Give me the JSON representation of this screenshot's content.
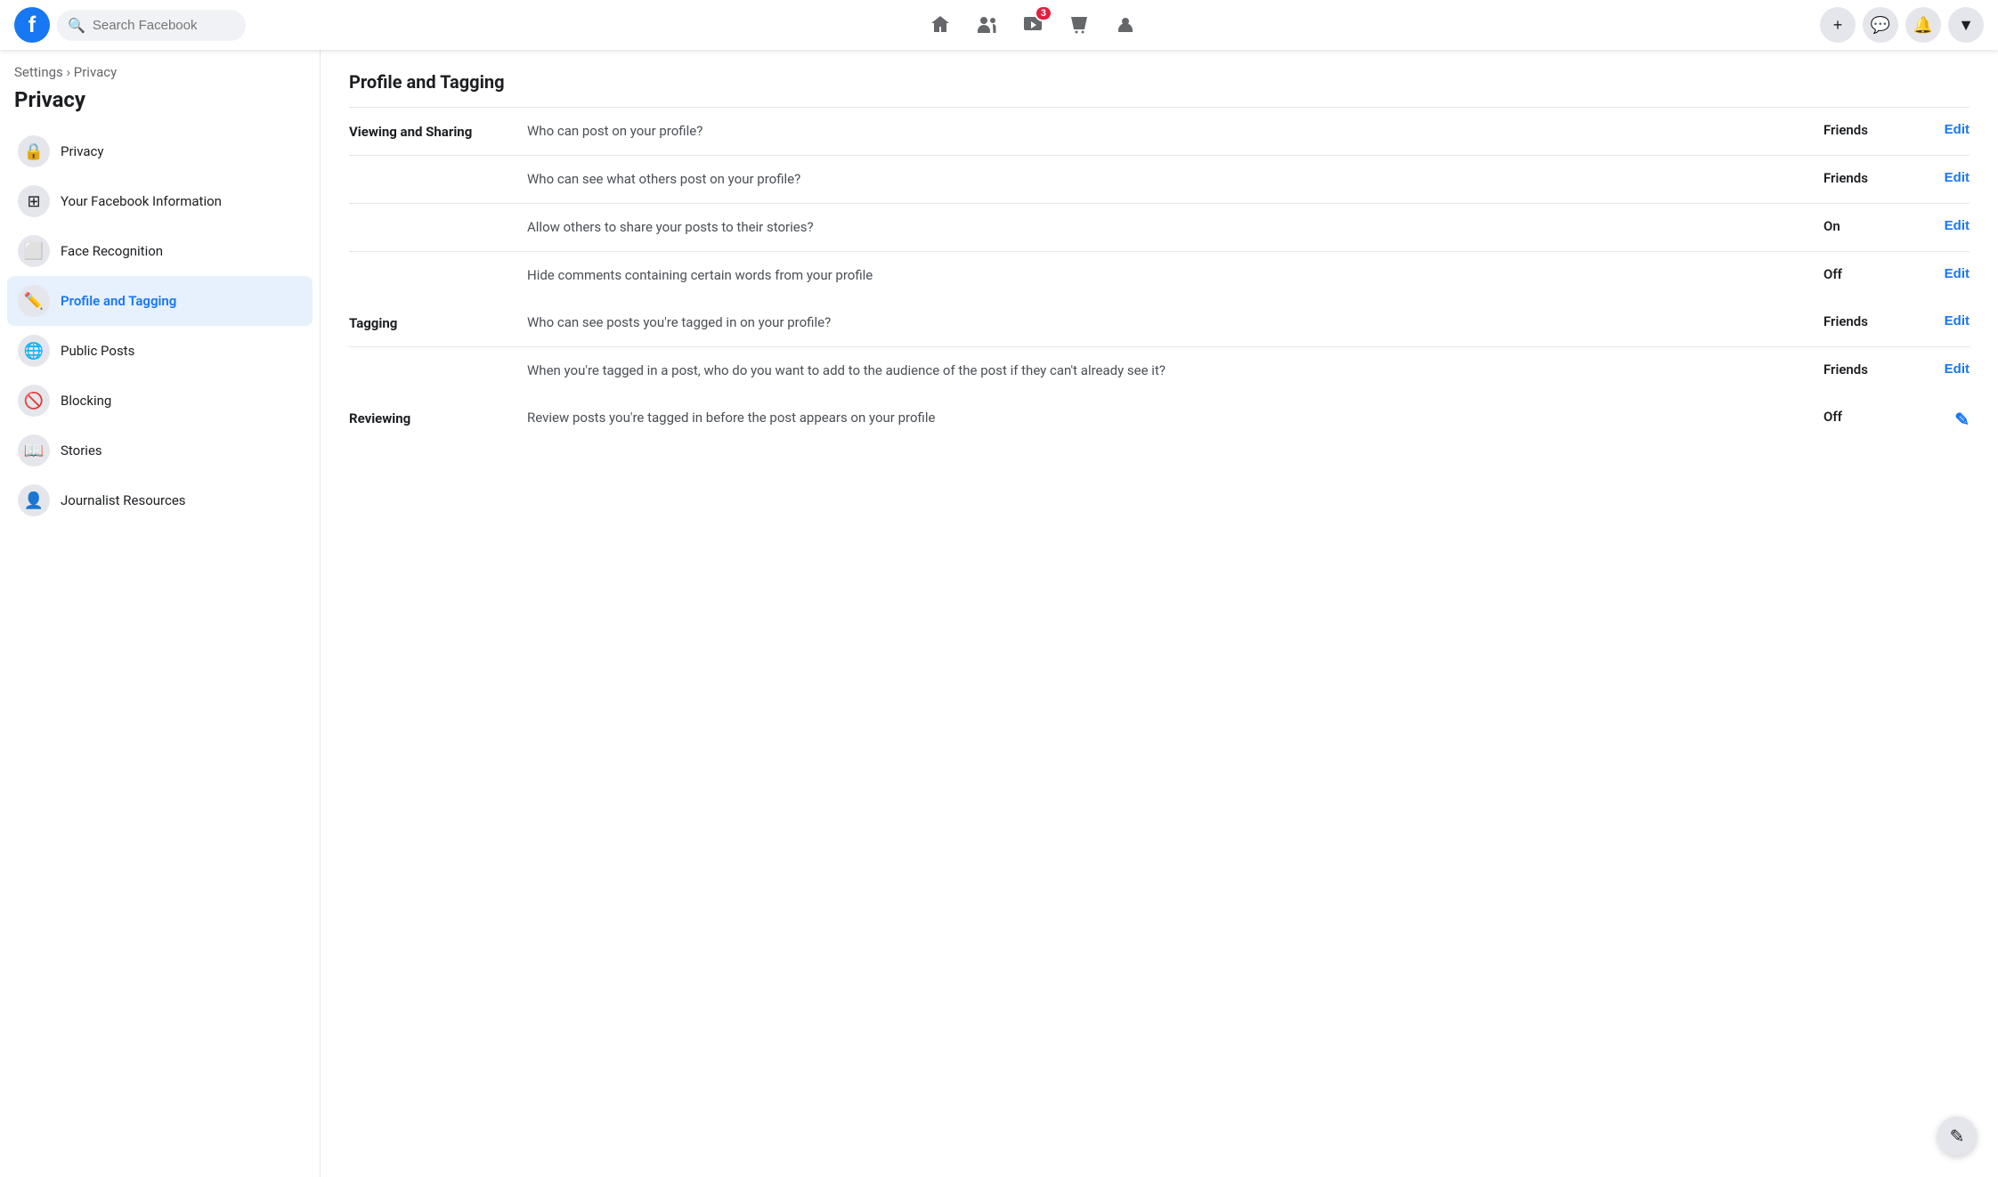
{
  "nav": {
    "logo": "f",
    "search_placeholder": "Search Facebook",
    "notification_count": "3",
    "icons": [
      "home",
      "friends",
      "watch",
      "marketplace",
      "groups"
    ],
    "right_icons": [
      "plus",
      "messenger",
      "bell",
      "dropdown"
    ]
  },
  "sidebar": {
    "breadcrumb_parent": "Settings",
    "breadcrumb_separator": "›",
    "breadcrumb_current": "Privacy",
    "title": "Privacy",
    "items": [
      {
        "id": "privacy",
        "label": "Privacy",
        "icon": "🔒",
        "active": false
      },
      {
        "id": "facebook-info",
        "label": "Your Facebook Information",
        "icon": "⊞",
        "active": false
      },
      {
        "id": "face-recognition",
        "label": "Face Recognition",
        "icon": "⬜",
        "active": false
      },
      {
        "id": "profile-tagging",
        "label": "Profile and Tagging",
        "icon": "✏️",
        "active": true
      },
      {
        "id": "public-posts",
        "label": "Public Posts",
        "icon": "🌐",
        "active": false
      },
      {
        "id": "blocking",
        "label": "Blocking",
        "icon": "🚫",
        "active": false
      },
      {
        "id": "stories",
        "label": "Stories",
        "icon": "📖",
        "active": false
      },
      {
        "id": "journalist-resources",
        "label": "Journalist Resources",
        "icon": "👤",
        "active": false
      }
    ]
  },
  "main": {
    "title": "Profile and Tagging",
    "sections": [
      {
        "label": "Viewing and Sharing",
        "settings": [
          {
            "question": "Who can post on your profile?",
            "value": "Friends",
            "edit": "Edit"
          },
          {
            "question": "Who can see what others post on your profile?",
            "value": "Friends",
            "edit": "Edit"
          },
          {
            "question": "Allow others to share your posts to their stories?",
            "value": "On",
            "edit": "Edit"
          },
          {
            "question": "Hide comments containing certain words from your profile",
            "value": "Off",
            "edit": "Edit"
          }
        ]
      },
      {
        "label": "Tagging",
        "settings": [
          {
            "question": "Who can see posts you're tagged in on your profile?",
            "value": "Friends",
            "edit": "Edit"
          },
          {
            "question": "When you're tagged in a post, who do you want to add to the audience of the post if they can't already see it?",
            "value": "Friends",
            "edit": "Edit"
          }
        ]
      },
      {
        "label": "Reviewing",
        "settings": [
          {
            "question": "Review posts you're tagged in before the post appears on your profile",
            "value": "Off",
            "edit": "✎"
          }
        ]
      }
    ]
  }
}
